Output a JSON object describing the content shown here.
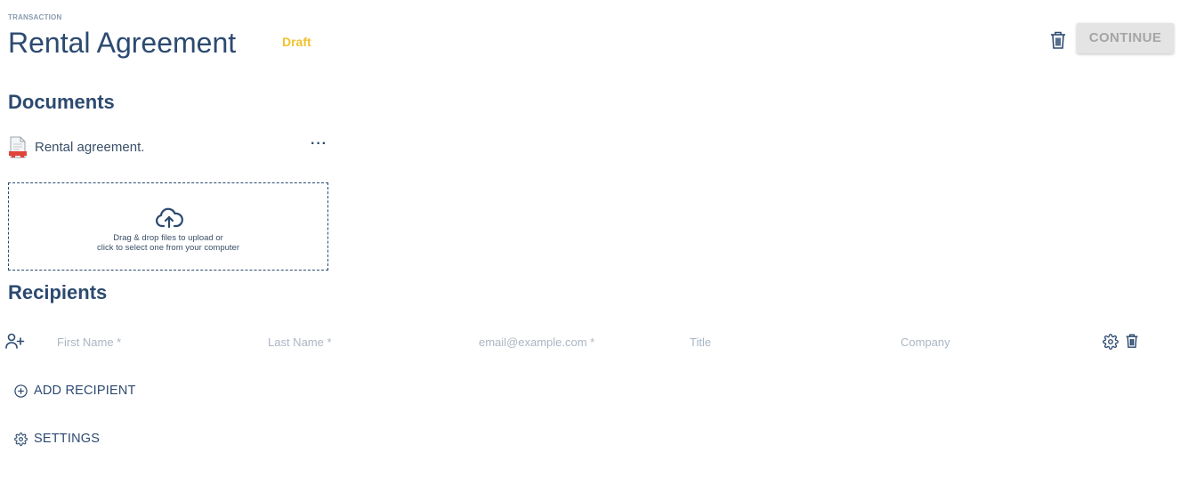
{
  "header": {
    "eyebrow": "TRANSACTION",
    "title": "Rental Agreement",
    "status": "Draft",
    "continue_label": "CONTINUE",
    "delete_icon": "trash-icon"
  },
  "documents": {
    "heading": "Documents",
    "items": [
      {
        "name": "Rental agreement.",
        "icon": "pdf-file-icon",
        "menu_label": "···"
      }
    ],
    "dropzone": {
      "icon": "cloud-upload-icon",
      "line1": "Drag & drop files to upload or",
      "line2": "click to select one from your computer"
    }
  },
  "recipients": {
    "heading": "Recipients",
    "row": {
      "icon": "add-person-icon",
      "first_name_placeholder": "First Name *",
      "last_name_placeholder": "Last Name *",
      "email_placeholder": "email@example.com *",
      "title_placeholder": "Title",
      "company_placeholder": "Company",
      "first_name_value": "",
      "last_name_value": "",
      "email_value": "",
      "title_value": "",
      "company_value": "",
      "settings_icon": "gear-icon",
      "delete_icon": "trash-icon"
    },
    "add_label": "ADD RECIPIENT",
    "settings_label": "SETTINGS"
  },
  "colors": {
    "primary": "#2c4a70",
    "draft": "#f2c12e",
    "disabled_button_bg": "#e4e4e4",
    "disabled_button_text": "#a5a5a5",
    "placeholder": "#aab6c4",
    "pdf_red": "#e0453a"
  }
}
